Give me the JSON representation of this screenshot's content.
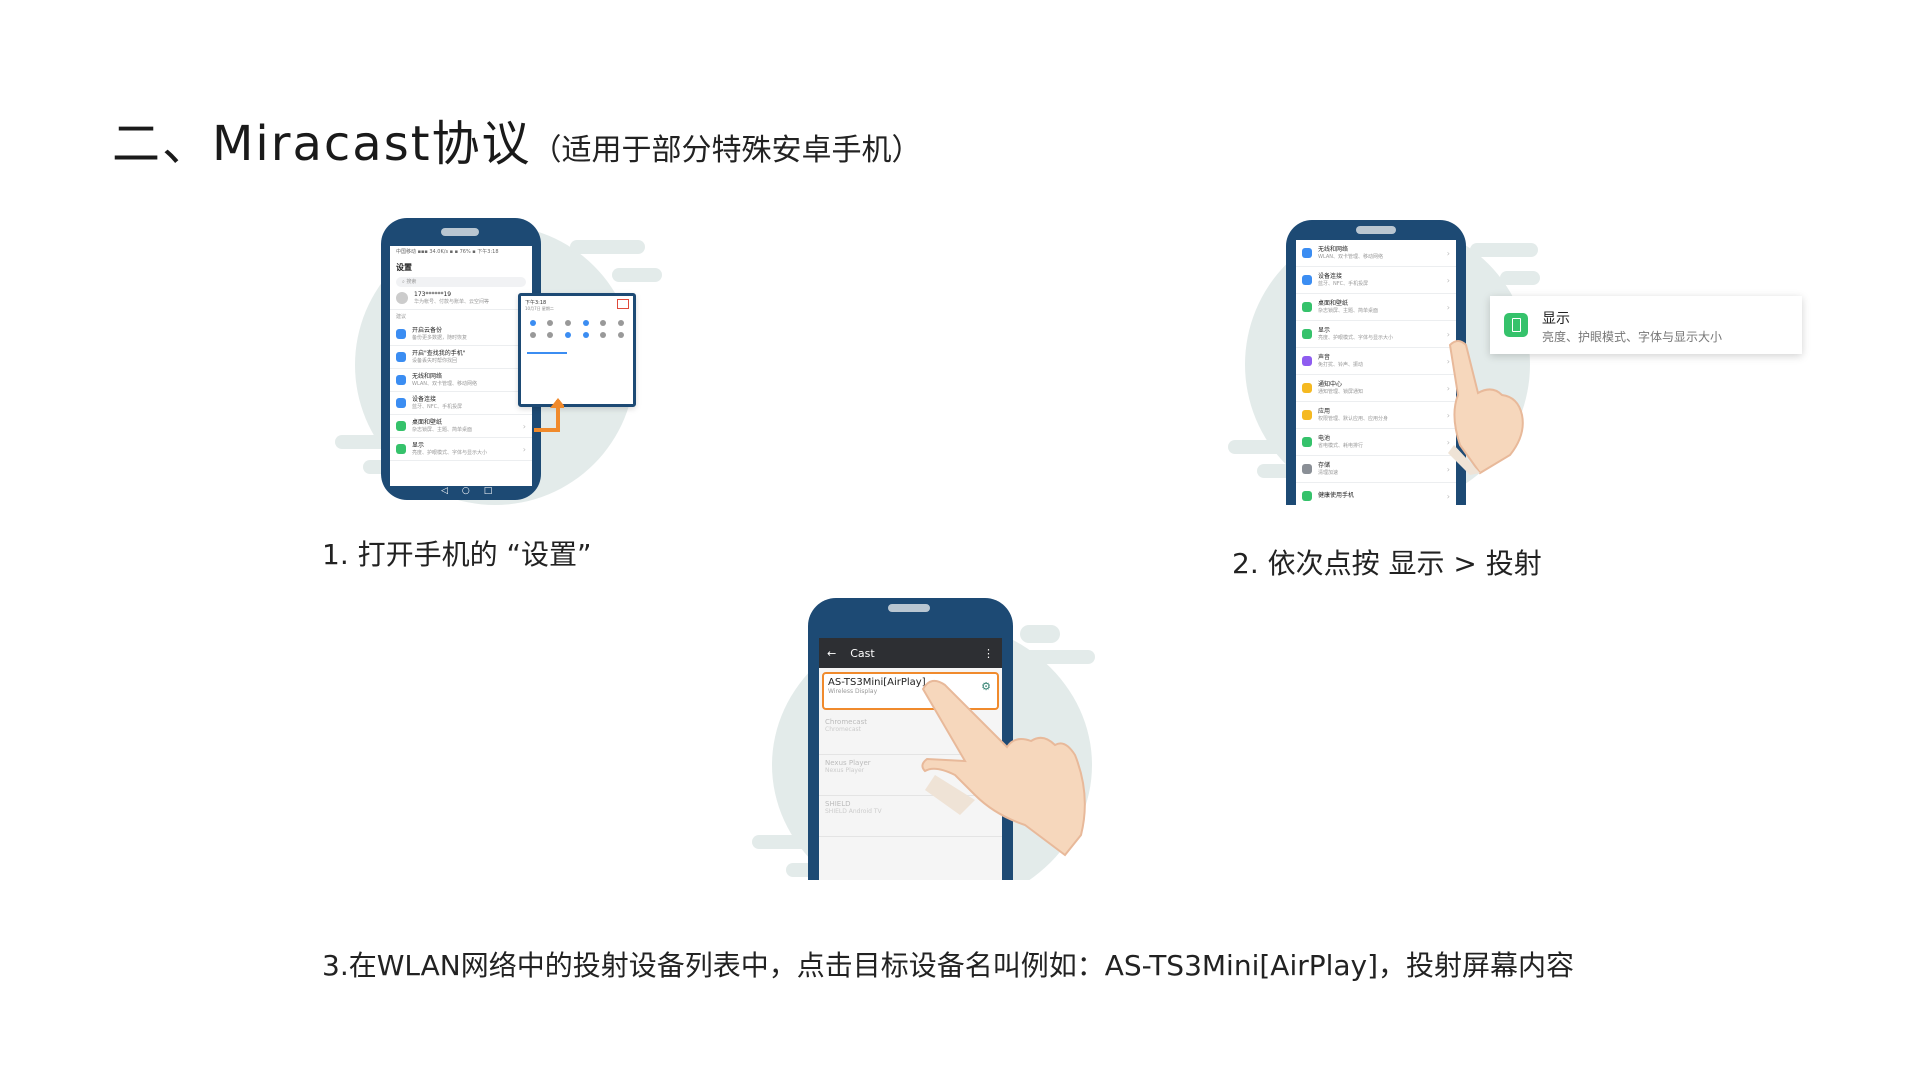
{
  "heading": {
    "main": "二、Miracast协议",
    "sub": "（适用于部分特殊安卓手机）"
  },
  "steps": [
    {
      "caption": "1. 打开手机的 “设置”"
    },
    {
      "caption": "2. 依次点按 显示 > 投射"
    },
    {
      "caption": "3.在WLAN网络中的投射设备列表中，点击目标设备名叫例如：AS-TS3Mini[AirPlay]，投射屏幕内容"
    }
  ],
  "phone1": {
    "status": "中国移动 ▪▪▪ 34.0K/s ▪     ▪ 76% ▪ 下午3:18",
    "title": "设置",
    "search_placeholder": "搜索",
    "account_name": "173******19",
    "account_desc": "华为帐号、付款与账单、云空间等",
    "section": "建议",
    "items": [
      {
        "t": "开启云备份",
        "d": "备份更多数据，随时恢复",
        "color": "#3b8df2"
      },
      {
        "t": "开启\"查找我的手机\"",
        "d": "设备丢失时帮你找回",
        "color": "#3b8df2"
      },
      {
        "t": "无线和网络",
        "d": "WLAN、双卡管理、移动网络",
        "color": "#3b8df2"
      },
      {
        "t": "设备连接",
        "d": "蓝牙、NFC、手机投屏",
        "color": "#3b8df2"
      },
      {
        "t": "桌面和壁纸",
        "d": "杂志锁屏、主题、简单桌面",
        "color": "#35c26b"
      },
      {
        "t": "显示",
        "d": "亮度、护眼模式、字体与显示大小",
        "color": "#35c26b"
      }
    ],
    "qs_time": "下午3:18",
    "qs_date": "10月7日 星期二"
  },
  "phone2": {
    "items": [
      {
        "t": "无线和网络",
        "d": "WLAN、双卡管理、移动网络",
        "color": "#3b8df2"
      },
      {
        "t": "设备连接",
        "d": "蓝牙、NFC、手机投屏",
        "color": "#3b8df2"
      },
      {
        "t": "桌面和壁纸",
        "d": "杂志锁屏、主题、简单桌面",
        "color": "#35c26b"
      },
      {
        "t": "显示",
        "d": "亮度、护眼模式、字体与显示大小",
        "color": "#35c26b"
      },
      {
        "t": "声音",
        "d": "免打扰、铃声、振动",
        "color": "#8e5cf0"
      },
      {
        "t": "通知中心",
        "d": "通知管理、锁屏通知",
        "color": "#f5b921"
      },
      {
        "t": "应用",
        "d": "权限管理、默认应用、应用分身",
        "color": "#f5b921"
      },
      {
        "t": "电池",
        "d": "省电模式、耗电排行",
        "color": "#35c26b"
      },
      {
        "t": "存储",
        "d": "清理加速",
        "color": "#8a8f96"
      },
      {
        "t": "健康使用手机",
        "d": "",
        "color": "#35c26b"
      }
    ],
    "callout_title": "显示",
    "callout_desc": "亮度、护眼模式、字体与显示大小"
  },
  "phone3": {
    "toolbar_back": "←",
    "toolbar_title": "Cast",
    "toolbar_menu": "⋮",
    "devices": [
      {
        "name": "AS-TS3Mini[AirPlay]",
        "desc": "Wireless Display",
        "highlight": true
      },
      {
        "name": "Chromecast",
        "desc": "Chromecast",
        "highlight": false
      },
      {
        "name": "Nexus Player",
        "desc": "Nexus Player",
        "highlight": false
      },
      {
        "name": "SHIELD",
        "desc": "SHIELD Android TV",
        "highlight": false
      }
    ]
  },
  "colors": {
    "phone_body": "#1d4a74",
    "background_circle": "#e3ebea",
    "highlight_orange": "#f08a2c",
    "setting_green": "#35c26b"
  }
}
